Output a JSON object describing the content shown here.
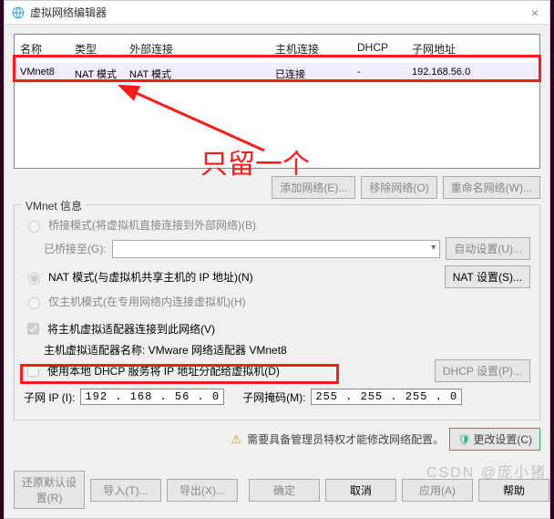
{
  "window": {
    "title": "虚拟网络编辑器"
  },
  "table": {
    "headers": {
      "name": "名称",
      "type": "类型",
      "ext": "外部连接",
      "host": "主机连接",
      "dhcp": "DHCP",
      "subnet": "子网地址"
    },
    "row": {
      "name": "VMnet8",
      "type": "NAT 模式",
      "ext": "NAT 模式",
      "host": "已连接",
      "dhcp": "-",
      "subnet": "192.168.56.0"
    }
  },
  "annotation": {
    "text": "只留一个"
  },
  "net_buttons": {
    "add": "添加网络(E)...",
    "remove": "移除网络(O)",
    "rename": "重命名网络(W)..."
  },
  "group_title": "VMnet 信息",
  "radios": {
    "bridge": "桥接模式(将虚拟机直接连接到外部网络)(B)",
    "bridge_to": "已桥接至(G):",
    "auto_set": "自动设置(U)...",
    "nat": "NAT 模式(与虚拟机共享主机的 IP 地址)(N)",
    "nat_set": "NAT 设置(S)...",
    "hostonly": "仅主机模式(在专用网络内连接虚拟机)(H)"
  },
  "checks": {
    "connect_host": "将主机虚拟适配器连接到此网络(V)",
    "adapter_label": "主机虚拟适配器名称: VMware 网络适配器 VMnet8",
    "use_dhcp": "使用本地 DHCP 服务将 IP 地址分配给虚拟机(D)",
    "dhcp_set": "DHCP 设置(P)..."
  },
  "ip": {
    "subnet_label": "子网 IP (I):",
    "subnet_value": "192 . 168 . 56 . 0",
    "mask_label": "子网掩码(M):",
    "mask_value": "255 . 255 . 255 . 0"
  },
  "warning": {
    "text": "需要具备管理员特权才能修改网络配置。",
    "btn": "更改设置(C)"
  },
  "bottom": {
    "restore": "还原默认设置(R)",
    "import": "导入(T)...",
    "export": "导出(X)...",
    "ok": "确定",
    "cancel": "取消",
    "apply": "应用(A)",
    "help": "帮助"
  },
  "watermark": "CSDN @庞小猪"
}
